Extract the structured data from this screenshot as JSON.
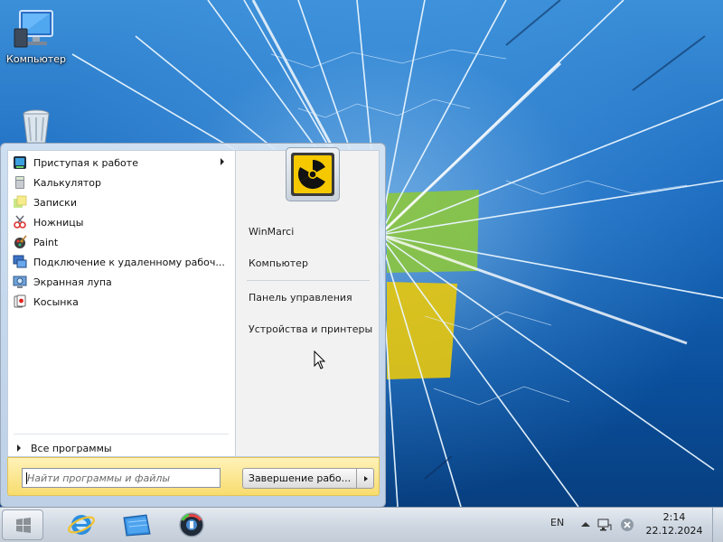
{
  "desktop": {
    "icons": [
      {
        "label": "Компьютер"
      },
      {
        "label": ""
      }
    ]
  },
  "start_menu": {
    "programs": [
      {
        "label": "Приступая к работе",
        "icon": "getting-started-icon",
        "has_submenu": true
      },
      {
        "label": "Калькулятор",
        "icon": "calculator-icon"
      },
      {
        "label": "Записки",
        "icon": "sticky-notes-icon"
      },
      {
        "label": "Ножницы",
        "icon": "scissors-icon"
      },
      {
        "label": "Paint",
        "icon": "paint-icon"
      },
      {
        "label": "Подключение к удаленному рабоч...",
        "icon": "remote-desktop-icon"
      },
      {
        "label": "Экранная лупа",
        "icon": "magnifier-icon"
      },
      {
        "label": "Косынка",
        "icon": "solitaire-icon"
      }
    ],
    "all_programs": "Все программы",
    "right_links": {
      "user": "WinMarci",
      "computer": "Компьютер",
      "control_panel": "Панель управления",
      "devices": "Устройства и принтеры"
    },
    "search": {
      "placeholder": "Найти программы и файлы",
      "value": ""
    },
    "shutdown_label": "Завершение рабо..."
  },
  "taskbar": {
    "language": "EN",
    "time": "2:14",
    "date": "22.12.2024"
  }
}
